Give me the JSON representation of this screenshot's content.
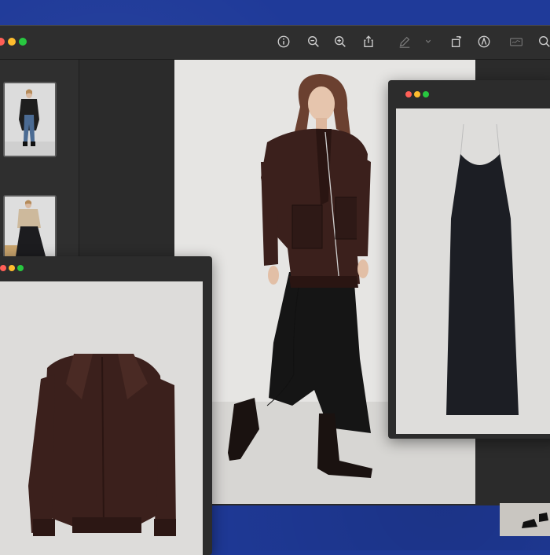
{
  "colors": {
    "background": "#1f3a99",
    "window_chrome": "#2c2c2c",
    "traffic_red": "#ff5f57",
    "traffic_yellow": "#febc2e",
    "traffic_green": "#28c840",
    "leather_brown": "#3b201c",
    "dress_black": "#1c1e24"
  },
  "toolbar": {
    "icons": [
      "info-icon",
      "zoom-out-icon",
      "zoom-in-icon",
      "share-icon",
      "markup-pen-icon",
      "chevron-down-icon",
      "rotate-icon",
      "annotate-icon",
      "signature-icon",
      "search-icon"
    ]
  },
  "sidebar": {
    "thumbnails": [
      {
        "subject": "model-in-denim-and-black-coat"
      },
      {
        "subject": "model-in-beige-sweater-and-black-skirt"
      }
    ]
  },
  "images": {
    "main": "model-in-leather-jacket-and-black-skirt",
    "jacket_window": "brown-leather-jacket",
    "dress_window": "black-slip-dress",
    "corner_peek": "black-shoes"
  }
}
